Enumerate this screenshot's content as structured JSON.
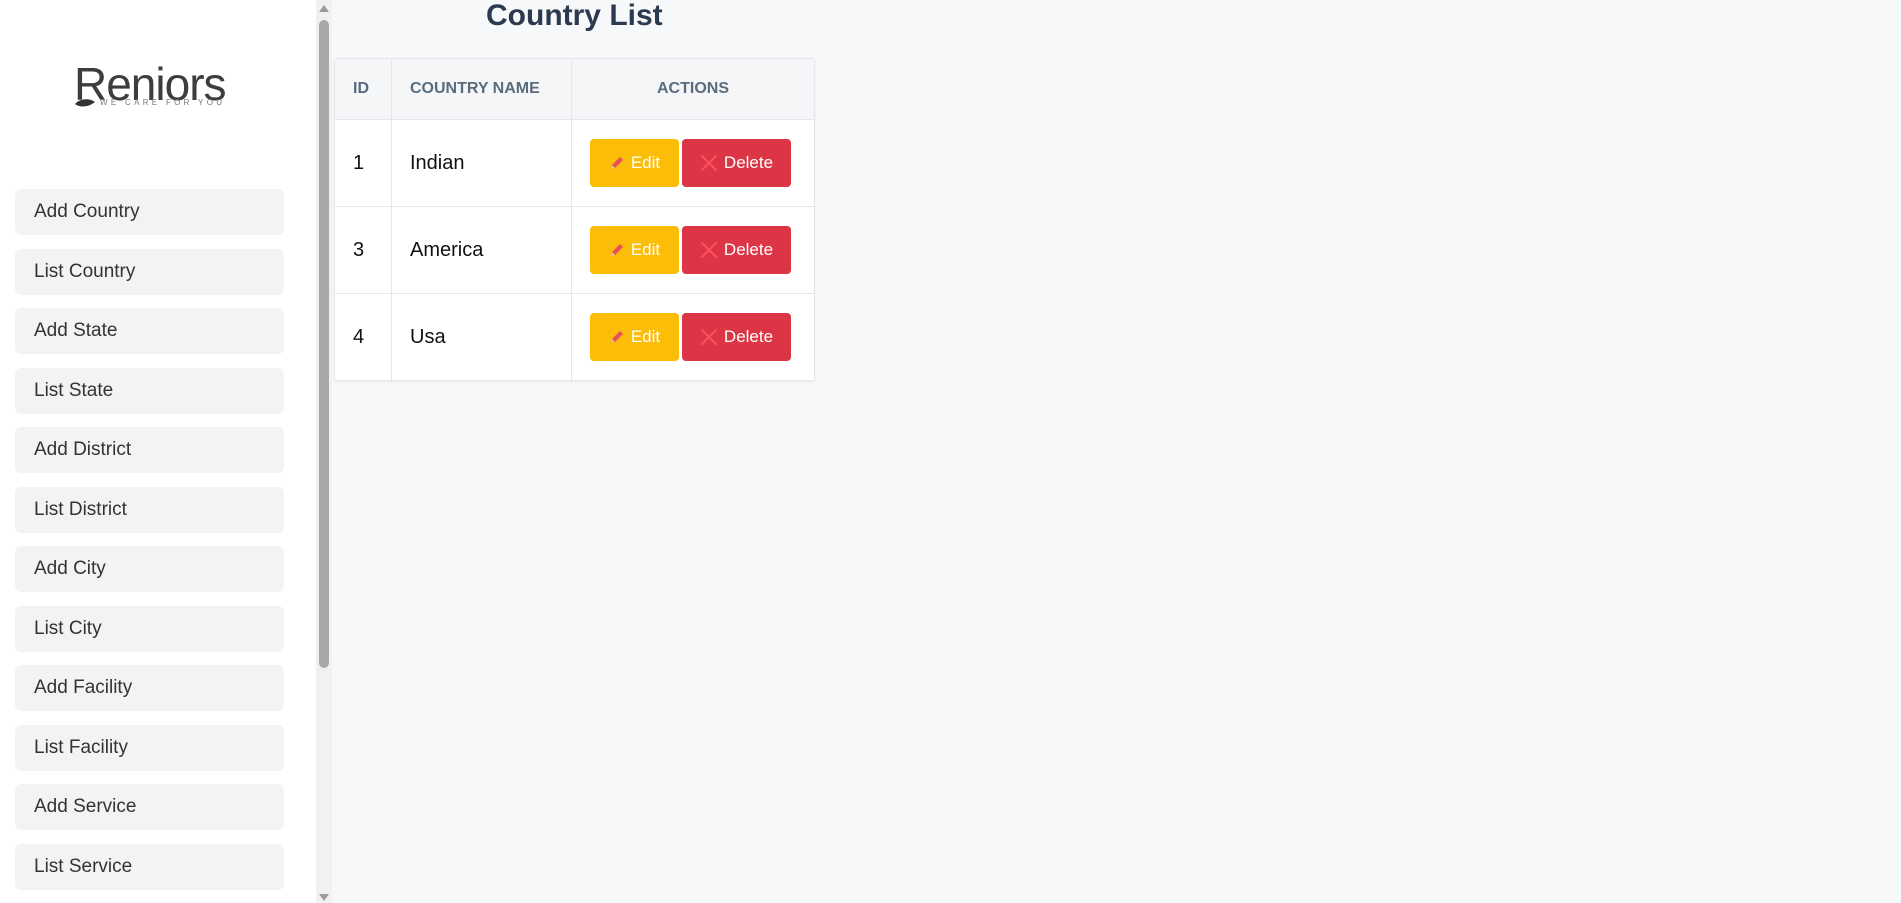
{
  "logo": {
    "name": "Reniors",
    "tagline": "WE CARE FOR YOU"
  },
  "sidebar": {
    "items": [
      {
        "label": "Add Country"
      },
      {
        "label": "List Country"
      },
      {
        "label": "Add State"
      },
      {
        "label": "List State"
      },
      {
        "label": "Add District"
      },
      {
        "label": "List District"
      },
      {
        "label": "Add City"
      },
      {
        "label": "List City"
      },
      {
        "label": "Add Facility"
      },
      {
        "label": "List Facility"
      },
      {
        "label": "Add Service"
      },
      {
        "label": "List Service"
      }
    ]
  },
  "page": {
    "title": "Country List"
  },
  "table": {
    "headers": {
      "id": "ID",
      "name": "COUNTRY NAME",
      "actions": "ACTIONS"
    },
    "rows": [
      {
        "id": "1",
        "name": "Indian"
      },
      {
        "id": "3",
        "name": "America"
      },
      {
        "id": "4",
        "name": "Usa"
      }
    ],
    "edit_label": "Edit",
    "delete_label": "Delete"
  },
  "colors": {
    "edit": "#fbbd08",
    "delete": "#dc3545",
    "title": "#2b3a4e"
  },
  "icons": {
    "edit": "pencil-icon",
    "delete": "close-icon"
  }
}
